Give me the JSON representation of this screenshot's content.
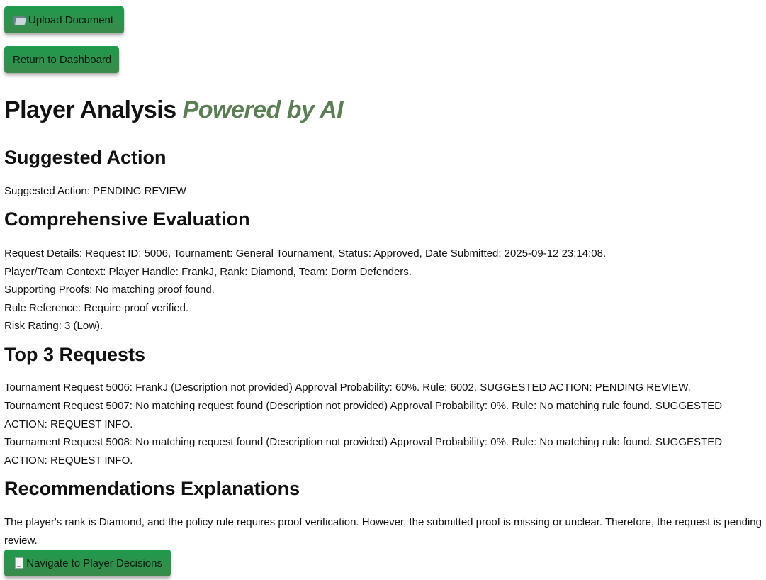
{
  "buttons": {
    "upload": "Upload Document",
    "return": "Return to Dashboard",
    "navigate": "Navigate to Player Decisions"
  },
  "header": {
    "title": "Player Analysis",
    "subtitle": "Powered by AI"
  },
  "suggested": {
    "heading": "Suggested Action",
    "text": "Suggested Action: PENDING REVIEW"
  },
  "evaluation": {
    "heading": "Comprehensive Evaluation",
    "lines": [
      "Request Details: Request ID: 5006, Tournament: General Tournament, Status: Approved, Date Submitted: 2025-09-12 23:14:08.",
      "Player/Team Context: Player Handle: FrankJ, Rank: Diamond, Team: Dorm Defenders.",
      "Supporting Proofs: No matching proof found.",
      "Rule Reference: Require proof verified.",
      "Risk Rating: 3 (Low)."
    ]
  },
  "top_requests": {
    "heading": "Top 3 Requests",
    "items": [
      "Tournament Request 5006: FrankJ (Description not provided) Approval Probability: 60%. Rule: 6002. SUGGESTED ACTION: PENDING REVIEW.",
      "Tournament Request 5007: No matching request found (Description not provided) Approval Probability: 0%. Rule: No matching rule found. SUGGESTED ACTION: REQUEST INFO.",
      "Tournament Request 5008: No matching request found (Description not provided) Approval Probability: 0%. Rule: No matching rule found. SUGGESTED ACTION: REQUEST INFO."
    ]
  },
  "recommendations": {
    "heading": "Recommendations Explanations",
    "text": "The player's rank is Diamond, and the policy rule requires proof verification. However, the submitted proof is missing or unclear. Therefore, the request is pending review."
  },
  "icons": {
    "upload": "folder-icon",
    "navigate": "document-icon"
  },
  "colors": {
    "button_green": "#2a9150",
    "ai_accent": "#5c7d55"
  }
}
